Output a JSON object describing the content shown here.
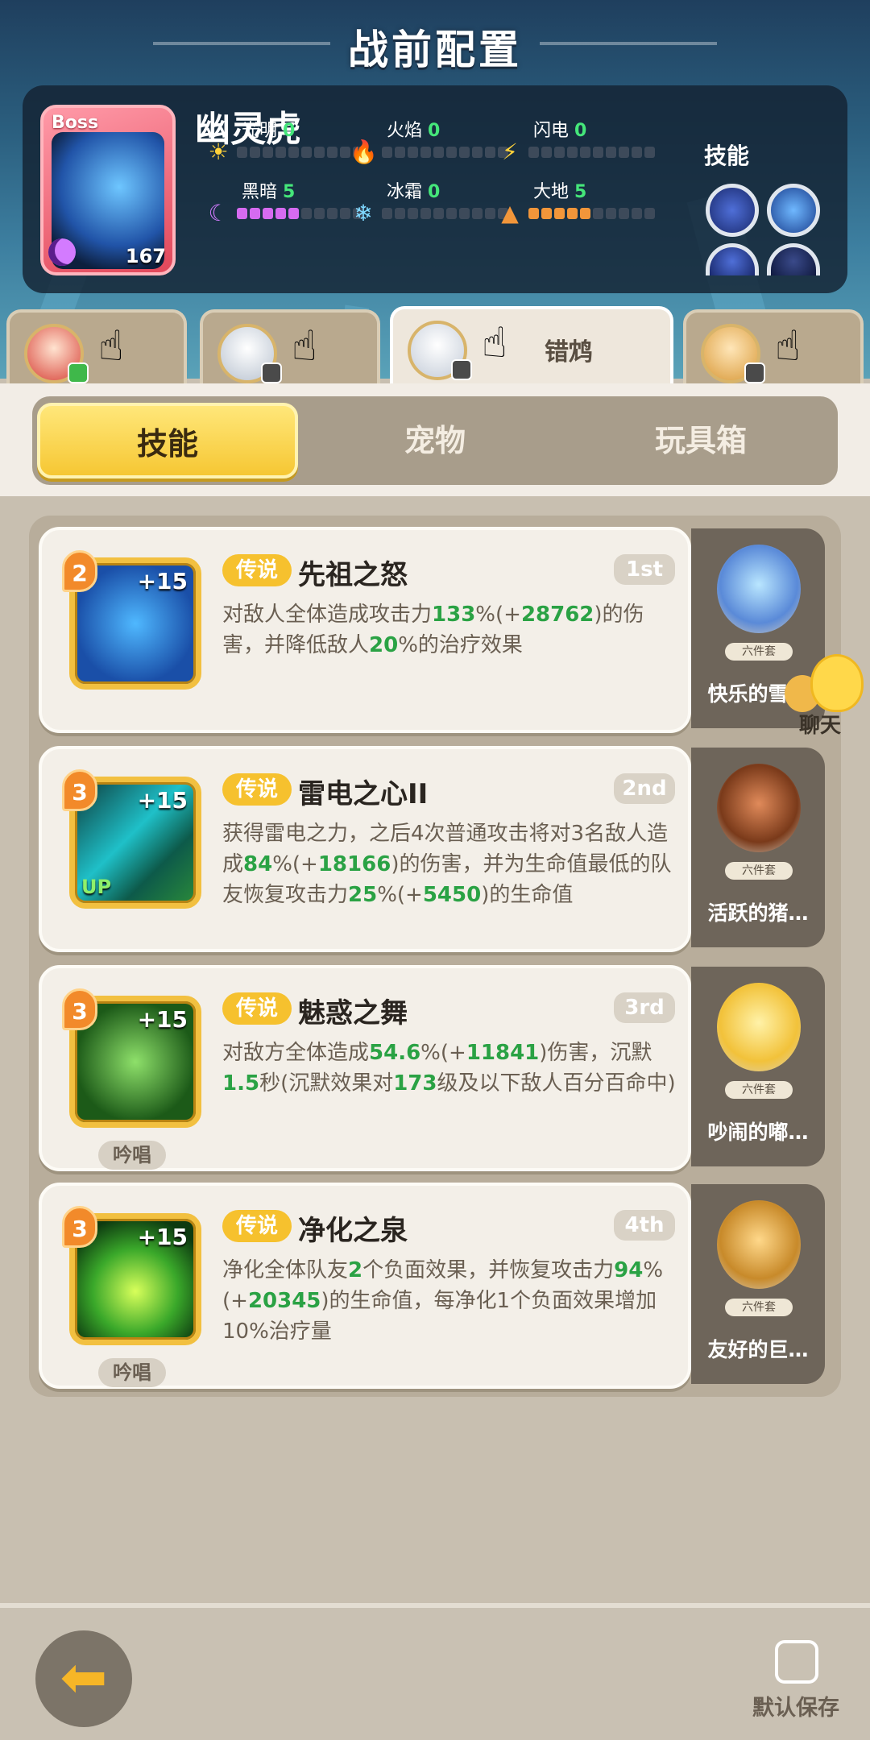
{
  "header": {
    "title": "战前配置"
  },
  "boss": {
    "tag": "Boss",
    "name": "幽灵虎",
    "level": "167",
    "skills_label": "技能",
    "elements": [
      {
        "name": "光明",
        "value": "0",
        "icon": "sun-icon",
        "filled": 0
      },
      {
        "name": "火焰",
        "value": "0",
        "icon": "flame-icon",
        "filled": 0
      },
      {
        "name": "闪电",
        "value": "0",
        "icon": "lightning-icon",
        "filled": 0
      },
      {
        "name": "黑暗",
        "value": "5",
        "icon": "moon-icon",
        "filled": 5
      },
      {
        "name": "冰霜",
        "value": "0",
        "icon": "snowflake-icon",
        "filled": 0
      },
      {
        "name": "大地",
        "value": "5",
        "icon": "earth-icon",
        "filled": 5
      }
    ]
  },
  "heroes": [
    {
      "name": "",
      "active": false
    },
    {
      "name": "",
      "active": false
    },
    {
      "name": "错鸩",
      "active": true
    },
    {
      "name": "",
      "active": false
    }
  ],
  "mode_tabs": [
    {
      "label": "技能",
      "active": true
    },
    {
      "label": "宠物",
      "active": false
    },
    {
      "label": "玩具箱",
      "active": false
    }
  ],
  "skills": [
    {
      "level": "2",
      "plus": "+15",
      "rarity": "传说",
      "name": "先祖之怒",
      "order": "1st",
      "desc_parts": [
        "对敌人全体造成攻击力",
        "133",
        "%(+",
        "28762",
        ")的伤害，并降低敌人",
        "20",
        "%的治疗效果"
      ],
      "chant": "",
      "up": ""
    },
    {
      "level": "3",
      "plus": "+15",
      "rarity": "传说",
      "name": "雷电之心II",
      "order": "2nd",
      "desc_parts": [
        "获得雷电之力，之后4次普通攻击将对3名敌人造成",
        "84",
        "%(+",
        "18166",
        ")的伤害，并为生命值最低的队友恢复攻击力",
        "25",
        "%(+",
        "5450",
        ")的生命值"
      ],
      "chant": "",
      "up": "UP"
    },
    {
      "level": "3",
      "plus": "+15",
      "rarity": "传说",
      "name": "魅惑之舞",
      "order": "3rd",
      "desc_parts": [
        "对敌方全体造成",
        "54.6",
        "%(+",
        "11841",
        ")伤害，沉默",
        "1.5",
        "秒(沉默效果对",
        "173",
        "级及以下敌人百分百命中)"
      ],
      "chant": "吟唱",
      "up": ""
    },
    {
      "level": "3",
      "plus": "+15",
      "rarity": "传说",
      "name": "净化之泉",
      "order": "4th",
      "desc_parts": [
        "净化全体队友",
        "2",
        "个负面效果，并恢复攻击力",
        "94",
        "%(+",
        "20345",
        ")的生命值，每净化1个负面效果增加10%治疗量"
      ],
      "chant": "吟唱",
      "up": ""
    }
  ],
  "pets": [
    {
      "name": "快乐的雪…",
      "set": "六件套"
    },
    {
      "name": "活跃的猪…",
      "set": "六件套"
    },
    {
      "name": "吵闹的嘟…",
      "set": "六件套"
    },
    {
      "name": "友好的巨…",
      "set": "六件套"
    }
  ],
  "chat": {
    "label": "聊天"
  },
  "footer": {
    "save_label": "默认保存"
  },
  "colors": {
    "accent_yellow": "#f6c733",
    "highlight_green": "#2aa244",
    "rarity_gold": "#f6c12e"
  }
}
